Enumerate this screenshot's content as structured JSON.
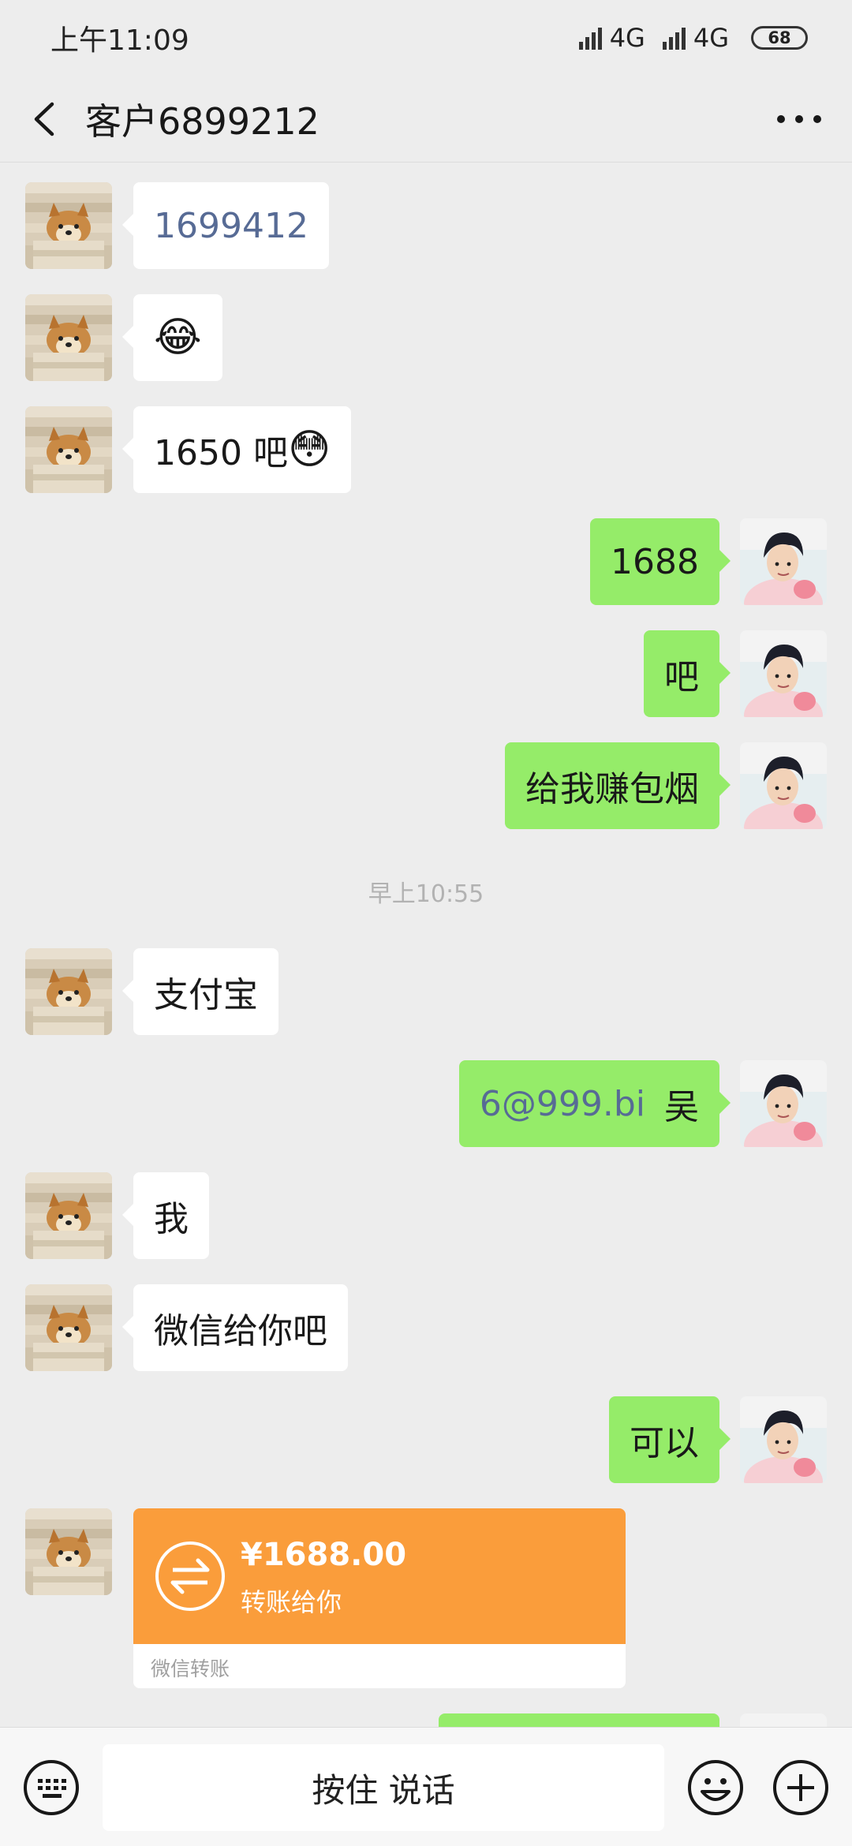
{
  "status_bar": {
    "time": "上午11:09",
    "network_1": "4G",
    "network_2": "4G",
    "battery": "68"
  },
  "header": {
    "title": "客户6899212"
  },
  "messages": [
    {
      "side": "left",
      "text": "1699412"
    },
    {
      "side": "left",
      "text": "😂"
    },
    {
      "side": "left",
      "text": "1650 吧",
      "emoji": "😳"
    },
    {
      "side": "right",
      "text": "1688"
    },
    {
      "side": "right",
      "text": "吧"
    },
    {
      "side": "right",
      "text": "给我赚包烟"
    },
    {
      "side": "left",
      "text": "支付宝"
    },
    {
      "side": "right",
      "link": "6@999.bi",
      "text": "吴"
    },
    {
      "side": "left",
      "text": "我"
    },
    {
      "side": "left",
      "text": "微信给你吧"
    },
    {
      "side": "right",
      "text": "可以"
    }
  ],
  "timestamp": "早上10:55",
  "transfer": {
    "amount": "¥1688.00",
    "description": "转账给你",
    "footer": "微信转账"
  },
  "input_bar": {
    "talk_label": "按住 说话"
  },
  "icons": {
    "keyboard": "keyboard-icon",
    "emoji": "smiley-icon",
    "plus": "plus-icon",
    "back": "back-arrow-icon",
    "more": "more-dots-icon"
  },
  "colors": {
    "background": "#ededed",
    "bubble_sent": "#95ec69",
    "bubble_received": "#ffffff",
    "transfer": "#fa9d3b",
    "link": "#576b95"
  }
}
